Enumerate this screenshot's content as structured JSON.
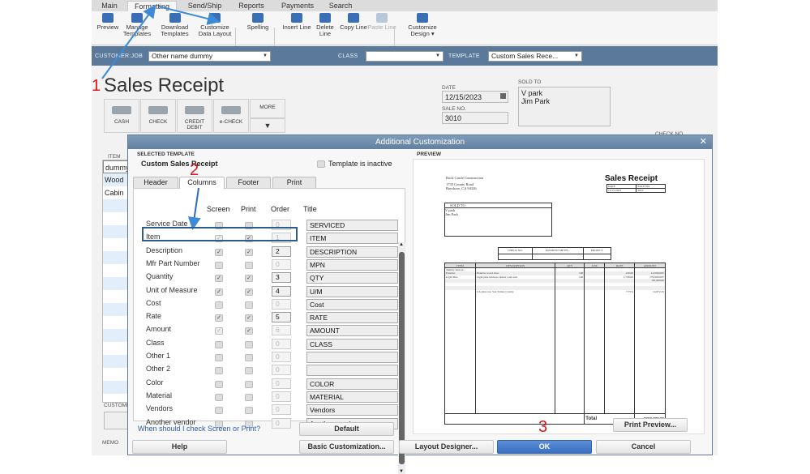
{
  "menu_tabs": [
    "Main",
    "Formatting",
    "Send/Ship",
    "Reports",
    "Payments",
    "Search"
  ],
  "active_tab": "Formatting",
  "toolbar": [
    {
      "label": "Preview",
      "icon": "preview-icon"
    },
    {
      "label": "Manage Templates",
      "icon": "templates-icon"
    },
    {
      "label": "Download Templates",
      "icon": "download-icon"
    },
    {
      "label": "Customize Data Layout",
      "icon": "customize-layout-icon"
    },
    {
      "label": "Spelling",
      "icon": "spelling-icon"
    },
    {
      "label": "Insert Line",
      "icon": "insert-line-icon"
    },
    {
      "label": "Delete Line",
      "icon": "delete-line-icon"
    },
    {
      "label": "Copy Line",
      "icon": "copy-line-icon"
    },
    {
      "label": "Paste Line",
      "icon": "paste-line-icon",
      "disabled": true
    },
    {
      "label": "Customize Design ▾",
      "icon": "customize-design-icon"
    }
  ],
  "bar": {
    "customer_label": "CUSTOMER:JOB",
    "customer_value": "Other name dummy",
    "class_label": "CLASS",
    "class_value": "",
    "template_label": "TEMPLATE",
    "template_value": "Custom Sales Rece..."
  },
  "form": {
    "title": "Sales Receipt",
    "payment_buttons": [
      "CASH",
      "CHECK",
      "CREDIT DEBIT",
      "e-CHECK",
      "MORE"
    ],
    "date_label": "DATE",
    "date_value": "12/15/2023",
    "sale_no_label": "SALE NO.",
    "sale_no_value": "3010",
    "sold_to_label": "SOLD TO",
    "sold_to_lines": [
      "V park",
      "Jim Park"
    ],
    "check_no_label": "CHECK NO.",
    "item_label": "ITEM",
    "items": [
      "dummy",
      "Wood",
      "Cabin"
    ],
    "customer_msg_label": "CUSTOMER MESSAGE",
    "memo_label": "MEMO"
  },
  "dialog": {
    "title": "Additional Customization",
    "selected_template_label": "SELECTED TEMPLATE",
    "template_name": "Custom Sales Receipt",
    "inactive_label": "Template is inactive",
    "tabs": [
      "Header",
      "Columns",
      "Footer",
      "Print"
    ],
    "active_tab": "Columns",
    "col_headers": [
      "Screen",
      "Print",
      "Order",
      "Title"
    ],
    "rows": [
      {
        "label": "Service Date",
        "screen": false,
        "print": false,
        "order": "0",
        "title": "SERVICED"
      },
      {
        "label": "Item",
        "screen": true,
        "print": true,
        "order": "1",
        "title": "ITEM",
        "screen_locked": true
      },
      {
        "label": "Description",
        "screen": true,
        "print": true,
        "order": "2",
        "title": "DESCRIPTION"
      },
      {
        "label": "Mfr Part Number",
        "screen": false,
        "print": false,
        "order": "0",
        "title": "MPN"
      },
      {
        "label": "Quantity",
        "screen": true,
        "print": true,
        "order": "3",
        "title": "QTY"
      },
      {
        "label": "Unit of Measure",
        "screen": true,
        "print": true,
        "order": "4",
        "title": "U/M"
      },
      {
        "label": "Cost",
        "screen": false,
        "print": false,
        "order": "0",
        "title": "Cost"
      },
      {
        "label": "Rate",
        "screen": true,
        "print": true,
        "order": "5",
        "title": "RATE"
      },
      {
        "label": "Amount",
        "screen": true,
        "print": true,
        "order": "6",
        "title": "AMOUNT",
        "screen_locked": true
      },
      {
        "label": "Class",
        "screen": false,
        "print": false,
        "order": "0",
        "title": "CLASS"
      },
      {
        "label": "Other 1",
        "screen": false,
        "print": false,
        "order": "0",
        "title": ""
      },
      {
        "label": "Other 2",
        "screen": false,
        "print": false,
        "order": "0",
        "title": ""
      },
      {
        "label": "Color",
        "screen": false,
        "print": false,
        "order": "0",
        "title": "COLOR"
      },
      {
        "label": "Material",
        "screen": false,
        "print": false,
        "order": "0",
        "title": "MATERIAL"
      },
      {
        "label": "Vendors",
        "screen": false,
        "print": false,
        "order": "0",
        "title": "Vendors"
      },
      {
        "label": "Another vendor",
        "screen": false,
        "print": false,
        "order": "0",
        "title": "Another vendor"
      }
    ],
    "help_link": "When should I check Screen or Print?",
    "default_btn": "Default",
    "preview_label": "PREVIEW",
    "print_preview_btn": "Print Preview...",
    "buttons": {
      "help": "Help",
      "basic": "Basic Customization...",
      "layout": "Layout Designer...",
      "ok": "OK",
      "cancel": "Cancel"
    },
    "preview": {
      "company": "Rock Castle Construction",
      "address1": "1735 County Road",
      "address2": "Bayshore, CA 94326",
      "title": "Sales Receipt",
      "date_h": "DATE",
      "saleno_h": "SALE NO.",
      "date": "12/15/2023",
      "saleno": "3010",
      "sold_to": "SOLD TO",
      "sold_lines": [
        "V park",
        "Jim Park"
      ],
      "pay_headers": [
        "CHECK NO.",
        "PAYMENT METH...",
        "PROJECT"
      ],
      "headers": [
        "ITEM",
        "DESCRIPTION",
        "QTY",
        "U/M",
        "RATE",
        "AMOUNT"
      ],
      "lines": [
        [
          "dummy item nt...",
          "",
          "",
          "",
          "",
          ""
        ],
        [
          "Exterior",
          "Exterior wood door",
          "100",
          "",
          "120.00",
          "12,000.00T"
        ],
        [
          "Light Pine",
          "Light pine kitchen cabinet wall unit",
          "100",
          "",
          "1,799.00",
          "179,900.00T"
        ],
        [
          "",
          "",
          "",
          "",
          "",
          "191,900.00"
        ],
        [
          "",
          "",
          "",
          "",
          "",
          ""
        ],
        [
          "",
          "",
          "",
          "",
          "",
          ""
        ],
        [
          "",
          "CA sales tax, San Tomas County",
          "",
          "",
          "7.75%",
          "14,872.25"
        ]
      ],
      "total_label": "Total",
      "total": "$206,772.25"
    }
  },
  "annotations": {
    "step1": "1",
    "step2": "2",
    "step3": "3",
    "arrow_color": "#3d8ad6",
    "step_color": "#e0141a"
  }
}
